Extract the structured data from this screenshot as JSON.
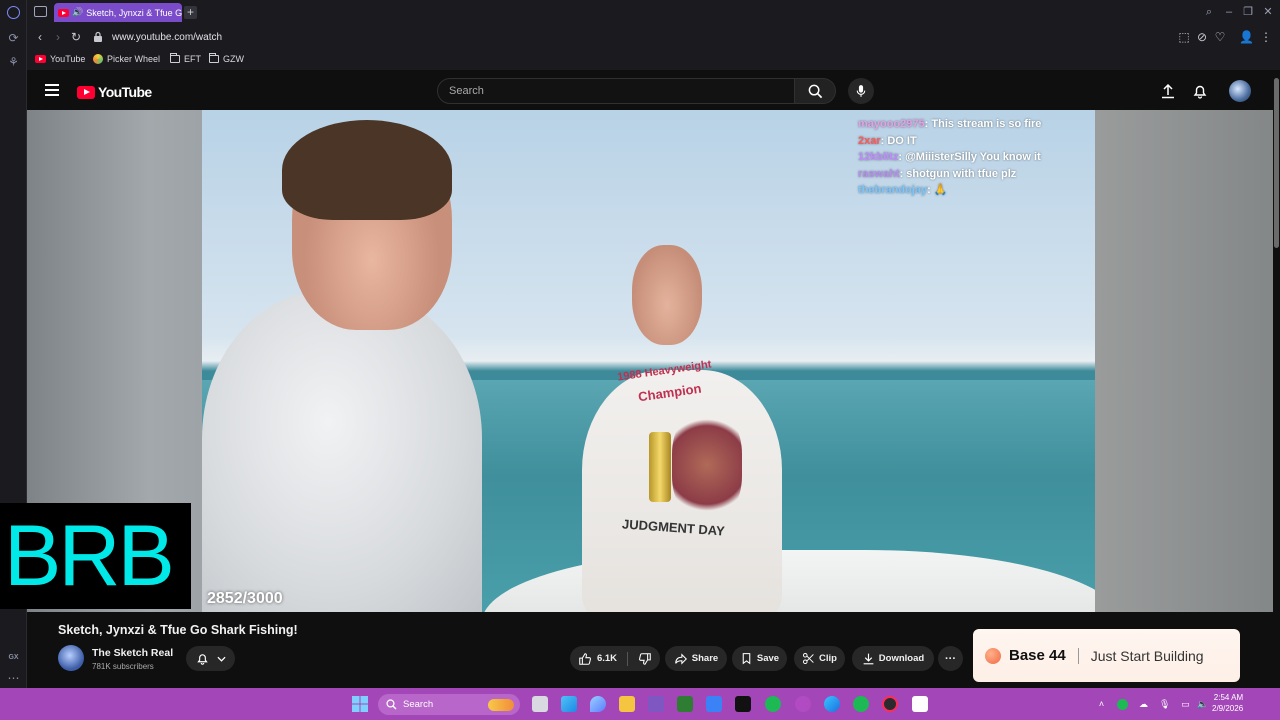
{
  "browser": {
    "active_tab_title": "Sketch, Jynxzi & Tfue G",
    "url": "www.youtube.com/watch",
    "bookmarks": [
      {
        "label": "YouTube",
        "icon": "youtube-icon"
      },
      {
        "label": "Picker Wheel",
        "icon": "picker-wheel-icon"
      },
      {
        "label": "EFT",
        "icon": "folder-icon"
      },
      {
        "label": "GZW",
        "icon": "folder-icon"
      }
    ],
    "sidebar_label": "GX",
    "new_tab_glyph": "+"
  },
  "youtube": {
    "logo_text": "YouTube",
    "search_placeholder": "Search",
    "accent": "#ff0033"
  },
  "video": {
    "chat": [
      {
        "user": "mayooo2975",
        "message": ": This stream is so fire"
      },
      {
        "user": "2xar",
        "message": ": DO IT"
      },
      {
        "user": "12kblitz",
        "message": ": @MiiisterSilly You know it"
      },
      {
        "user": "raswaht",
        "message": ": shotgun with tfue plz"
      },
      {
        "user": "thebrandojay",
        "message": ": 🙏"
      }
    ],
    "overlay_text": "BRB",
    "counter": "2852/3000",
    "shirt_text_1": "1988 Heavyweight",
    "shirt_text_2": "Champion",
    "shirt_text_3": "JUDGMENT DAY"
  },
  "below": {
    "title": "Sketch, Jynxzi & Tfue Go Shark Fishing!",
    "channel_name": "The Sketch Real",
    "subscribers": "781K subscribers",
    "like_count": "6.1K",
    "share_label": "Share",
    "save_label": "Save",
    "clip_label": "Clip",
    "download_label": "Download",
    "more_glyph": "···"
  },
  "ad": {
    "brand": "Base 44",
    "tagline": "Just Start Building"
  },
  "taskbar": {
    "search_placeholder": "Search",
    "time": "2:54 AM",
    "date": "2/9/2026",
    "color": "#a347b8"
  }
}
